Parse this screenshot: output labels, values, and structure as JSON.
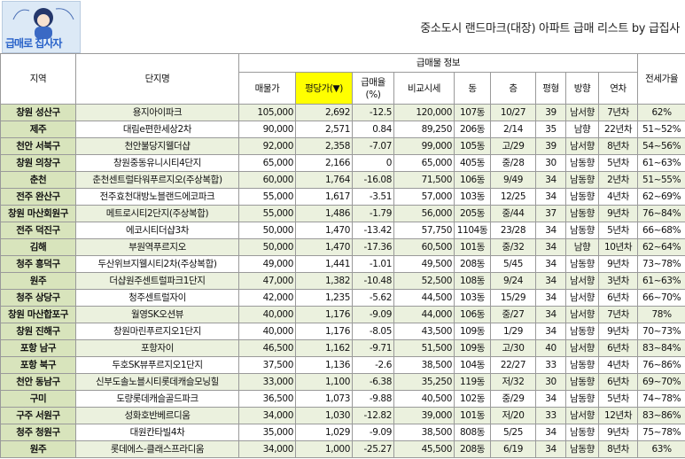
{
  "logo": {
    "alt_text": "급매로 집사자"
  },
  "title": "중소도시 랜드마크(대장) 아파트 급매 리스트 by 급집사",
  "headers": {
    "region": "지역",
    "complex": "단지명",
    "group": "급매물 정보",
    "price": "매물가",
    "per_pyeong": "평당가(▼)",
    "discount": "급매율\n(%)",
    "compare": "비교시세",
    "dong": "동",
    "floor": "층",
    "pyeong": "평형",
    "direction": "방향",
    "age": "연차",
    "jeonse": "전세가율"
  },
  "rows": [
    {
      "region": "창원 성산구",
      "name": "용지아이파크",
      "price": "105,000",
      "ppy": "2,692",
      "disc": "-12.5",
      "cmp": "120,000",
      "dong": "107동",
      "floor": "10/27",
      "py": "39",
      "dir": "남서향",
      "age": "7년차",
      "js": "62%"
    },
    {
      "region": "제주",
      "name": "대림e편한세상2차",
      "price": "90,000",
      "ppy": "2,571",
      "disc": "0.84",
      "cmp": "89,250",
      "dong": "206동",
      "floor": "2/14",
      "py": "35",
      "dir": "남향",
      "age": "22년차",
      "js": "51~52%"
    },
    {
      "region": "천안 서북구",
      "name": "천안불당지웰더샵",
      "price": "92,000",
      "ppy": "2,358",
      "disc": "-7.07",
      "cmp": "99,000",
      "dong": "105동",
      "floor": "고/29",
      "py": "39",
      "dir": "남서향",
      "age": "8년차",
      "js": "54~56%"
    },
    {
      "region": "창원 의창구",
      "name": "창원중동유니시티4단지",
      "price": "65,000",
      "ppy": "2,166",
      "disc": "0",
      "cmp": "65,000",
      "dong": "405동",
      "floor": "중/28",
      "py": "30",
      "dir": "남동향",
      "age": "5년차",
      "js": "61~63%"
    },
    {
      "region": "춘천",
      "name": "춘천센트럴타워푸르지오(주상복합)",
      "price": "60,000",
      "ppy": "1,764",
      "disc": "-16.08",
      "cmp": "71,500",
      "dong": "106동",
      "floor": "9/49",
      "py": "34",
      "dir": "남동향",
      "age": "2년차",
      "js": "51~55%"
    },
    {
      "region": "전주 완산구",
      "name": "전주효천대방노블랜드에코파크",
      "price": "55,000",
      "ppy": "1,617",
      "disc": "-3.51",
      "cmp": "57,000",
      "dong": "103동",
      "floor": "12/25",
      "py": "34",
      "dir": "남동향",
      "age": "4년차",
      "js": "62~69%"
    },
    {
      "region": "창원 마산회원구",
      "name": "메트로시티2단지(주상복합)",
      "price": "55,000",
      "ppy": "1,486",
      "disc": "-1.79",
      "cmp": "56,000",
      "dong": "205동",
      "floor": "중/44",
      "py": "37",
      "dir": "남동향",
      "age": "9년차",
      "js": "76~84%"
    },
    {
      "region": "전주 덕진구",
      "name": "에코시티더샵3차",
      "price": "50,000",
      "ppy": "1,470",
      "disc": "-13.42",
      "cmp": "57,750",
      "dong": "1104동",
      "floor": "23/28",
      "py": "34",
      "dir": "남동향",
      "age": "5년차",
      "js": "66~68%"
    },
    {
      "region": "김해",
      "name": "부원역푸르지오",
      "price": "50,000",
      "ppy": "1,470",
      "disc": "-17.36",
      "cmp": "60,500",
      "dong": "101동",
      "floor": "중/32",
      "py": "34",
      "dir": "남향",
      "age": "10년차",
      "js": "62~64%"
    },
    {
      "region": "청주 흥덕구",
      "name": "두산위브지웰시티2차(주상복합)",
      "price": "49,000",
      "ppy": "1,441",
      "disc": "-1.01",
      "cmp": "49,500",
      "dong": "208동",
      "floor": "5/45",
      "py": "34",
      "dir": "남동향",
      "age": "9년차",
      "js": "73~78%"
    },
    {
      "region": "원주",
      "name": "더샵원주센트럴파크1단지",
      "price": "47,000",
      "ppy": "1,382",
      "disc": "-10.48",
      "cmp": "52,500",
      "dong": "108동",
      "floor": "9/24",
      "py": "34",
      "dir": "남서향",
      "age": "3년차",
      "js": "61~63%"
    },
    {
      "region": "청주 상당구",
      "name": "청주센트럴자이",
      "price": "42,000",
      "ppy": "1,235",
      "disc": "-5.62",
      "cmp": "44,500",
      "dong": "103동",
      "floor": "15/29",
      "py": "34",
      "dir": "남서향",
      "age": "6년차",
      "js": "66~70%"
    },
    {
      "region": "창원 마산합포구",
      "name": "월영SK오션뷰",
      "price": "40,000",
      "ppy": "1,176",
      "disc": "-9.09",
      "cmp": "44,000",
      "dong": "106동",
      "floor": "중/27",
      "py": "34",
      "dir": "남서향",
      "age": "7년차",
      "js": "78%"
    },
    {
      "region": "창원 진해구",
      "name": "창원마린푸르지오1단지",
      "price": "40,000",
      "ppy": "1,176",
      "disc": "-8.05",
      "cmp": "43,500",
      "dong": "109동",
      "floor": "1/29",
      "py": "34",
      "dir": "남동향",
      "age": "9년차",
      "js": "70~73%"
    },
    {
      "region": "포항 남구",
      "name": "포항자이",
      "price": "46,500",
      "ppy": "1,162",
      "disc": "-9.71",
      "cmp": "51,500",
      "dong": "109동",
      "floor": "고/30",
      "py": "40",
      "dir": "남서향",
      "age": "6년차",
      "js": "83~84%"
    },
    {
      "region": "포항 북구",
      "name": "두호SK뷰푸르지오1단지",
      "price": "37,500",
      "ppy": "1,136",
      "disc": "-2.6",
      "cmp": "38,500",
      "dong": "104동",
      "floor": "22/27",
      "py": "33",
      "dir": "남동향",
      "age": "4년차",
      "js": "76~86%"
    },
    {
      "region": "천안 동남구",
      "name": "신부도솔노블시티롯데캐슬모닝힐",
      "price": "33,000",
      "ppy": "1,100",
      "disc": "-6.38",
      "cmp": "35,250",
      "dong": "119동",
      "floor": "저/32",
      "py": "30",
      "dir": "남동향",
      "age": "6년차",
      "js": "69~70%"
    },
    {
      "region": "구미",
      "name": "도량롯데캐슬골드파크",
      "price": "36,500",
      "ppy": "1,073",
      "disc": "-9.88",
      "cmp": "40,500",
      "dong": "102동",
      "floor": "중/29",
      "py": "34",
      "dir": "남동향",
      "age": "5년차",
      "js": "74~78%"
    },
    {
      "region": "구주 서원구",
      "name": "성화호반베르디움",
      "price": "34,000",
      "ppy": "1,030",
      "disc": "-12.82",
      "cmp": "39,000",
      "dong": "101동",
      "floor": "저/20",
      "py": "33",
      "dir": "남서향",
      "age": "12년차",
      "js": "83~86%"
    },
    {
      "region": "청주 청원구",
      "name": "대원칸타빌4차",
      "price": "35,000",
      "ppy": "1,029",
      "disc": "-9.09",
      "cmp": "38,500",
      "dong": "808동",
      "floor": "5/25",
      "py": "34",
      "dir": "남동향",
      "age": "9년차",
      "js": "75~78%"
    },
    {
      "region": "원주",
      "name": "롯데에스-클래스프라디움",
      "price": "34,000",
      "ppy": "1,000",
      "disc": "-25.27",
      "cmp": "45,500",
      "dong": "208동",
      "floor": "6/19",
      "py": "34",
      "dir": "남동향",
      "age": "8년차",
      "js": "63%"
    }
  ]
}
